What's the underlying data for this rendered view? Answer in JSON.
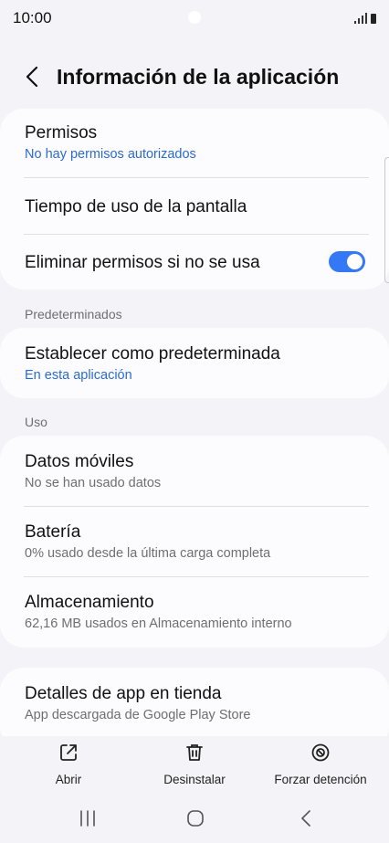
{
  "status": {
    "time": "10:00"
  },
  "header": {
    "title": "Información de la aplicación"
  },
  "card1": {
    "permisos": {
      "title": "Permisos",
      "subtitle": "No hay permisos autorizados"
    },
    "tiempo": {
      "title": "Tiempo de uso de la pantalla"
    },
    "eliminar": {
      "title": "Eliminar permisos si no se usa",
      "enabled": true
    }
  },
  "sections": {
    "predeterminados": "Predeterminados",
    "uso": "Uso"
  },
  "card2": {
    "title": "Establecer como predeterminada",
    "subtitle": "En esta aplicación"
  },
  "card3": {
    "datos": {
      "title": "Datos móviles",
      "subtitle": "No se han usado datos"
    },
    "bateria": {
      "title": "Batería",
      "subtitle": "0% usado desde la última carga completa"
    },
    "almacenamiento": {
      "title": "Almacenamiento",
      "subtitle": "62,16 MB usados en Almacenamiento interno"
    }
  },
  "card4": {
    "title": "Detalles de app en tienda",
    "subtitle": "App descargada de Google Play Store"
  },
  "actions": {
    "abrir": "Abrir",
    "desinstalar": "Desinstalar",
    "forzar": "Forzar detención"
  },
  "colors": {
    "accent": "#3478f6",
    "link": "#2b6bd0",
    "background": "#f4f3f8"
  }
}
